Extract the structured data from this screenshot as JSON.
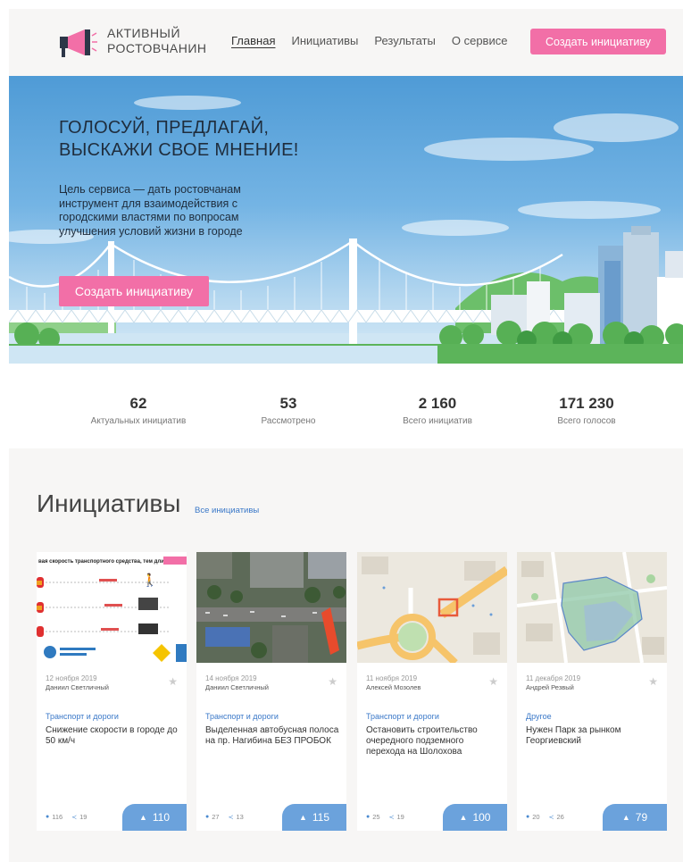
{
  "header": {
    "brand_line1": "АКТИВНЫЙ",
    "brand_line2": "РОСТОВЧАНИН",
    "nav": [
      {
        "label": "Главная",
        "active": true
      },
      {
        "label": "Инициативы",
        "active": false
      },
      {
        "label": "Результаты",
        "active": false
      },
      {
        "label": "О сервисе",
        "active": false
      }
    ],
    "create_button": "Создать инициативу"
  },
  "hero": {
    "title_line1": "ГОЛОСУЙ, ПРЕДЛАГАЙ,",
    "title_line2": "ВЫСКАЖИ СВОЕ МНЕНИЕ!",
    "description": "Цель сервиса — дать ростовчанам инструмент для взаимодействия с городскими властями по вопросам улучшения условий жизни в городе",
    "create_button": "Создать инициативу"
  },
  "stats": [
    {
      "value": "62",
      "label": "Актуальных инициатив"
    },
    {
      "value": "53",
      "label": "Рассмотрено"
    },
    {
      "value": "2 160",
      "label": "Всего инициатив"
    },
    {
      "value": "171 230",
      "label": "Всего голосов"
    }
  ],
  "initiatives": {
    "title": "Инициативы",
    "all_link": "Все инициативы",
    "cards": [
      {
        "date": "12 ноября 2019",
        "author": "Даниил Светличный",
        "category": "Транспорт и дороги",
        "title": "Снижение скорости в городе до 50 км/ч",
        "comments": "116",
        "shares": "19",
        "votes": "110",
        "thumb_headline": "вая скорость транспортного средства, тем длиннее"
      },
      {
        "date": "14 ноября 2019",
        "author": "Даниил Светличный",
        "category": "Транспорт и дороги",
        "title": "Выделенная автобусная полоса на пр. Нагибина БЕЗ ПРОБОК",
        "comments": "27",
        "shares": "13",
        "votes": "115"
      },
      {
        "date": "11 ноября 2019",
        "author": "Алексей Мозолев",
        "category": "Транспорт и дороги",
        "title": "Остановить строительство очередного подземного перехода на Шолохова",
        "comments": "25",
        "shares": "19",
        "votes": "100"
      },
      {
        "date": "11 декабря 2019",
        "author": "Андрей Резвый",
        "category": "Другое",
        "title": "Нужен Парк за рынком Георгиевский",
        "comments": "20",
        "shares": "26",
        "votes": "79"
      }
    ]
  },
  "colors": {
    "accent_pink": "#f26fa7",
    "vote_blue": "#6ba2dc",
    "link_blue": "#3a78c8"
  },
  "icons": [
    "megaphone-icon",
    "star-icon",
    "comment-icon",
    "share-icon",
    "thumbs-up-icon"
  ]
}
